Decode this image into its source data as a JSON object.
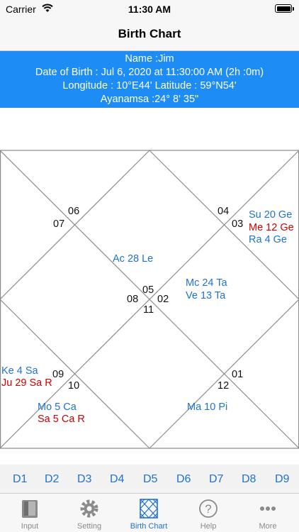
{
  "status_bar": {
    "carrier": "Carrier",
    "time": "11:30 AM"
  },
  "nav": {
    "title": "Birth Chart"
  },
  "info": {
    "name": "Name :Jim",
    "dob": "Date of Birth : Jul 6, 2020 at 11:30:00 AM (2h :0m)",
    "coords": "Longitude : 10°E44' Latitude : 59°N54'",
    "ayanamsa": "Ayanamsa :24° 8' 35\""
  },
  "chart": {
    "house_numbers": {
      "h06": "06",
      "h07": "07",
      "h04": "04",
      "h03": "03",
      "h05": "05",
      "h08": "08",
      "h02": "02",
      "h11": "11",
      "h09": "09",
      "h10": "10",
      "h01": "01",
      "h12": "12"
    },
    "planets": {
      "su": "Su 20 Ge",
      "me": "Me 12 Ge",
      "ra": "Ra 4 Ge",
      "ac": "Ac 28 Le",
      "mc": "Mc 24 Ta",
      "ve": "Ve 13 Ta",
      "ke": "Ke 4 Sa",
      "ju": "Ju 29 Sa R",
      "mo": "Mo 5 Ca",
      "sa": "Sa 5 Ca R",
      "ma": "Ma 10 Pi"
    },
    "colors": {
      "normal": "#1f72d0",
      "retro_or_combust": "#d00000",
      "house_number": "#111111",
      "lines": "#8c8c8c"
    }
  },
  "divisional_tabs": [
    "D1",
    "D2",
    "D3",
    "D4",
    "D5",
    "D6",
    "D7",
    "D8",
    "D9"
  ],
  "tab_bar": {
    "items": [
      {
        "label": "Input",
        "icon": "book-icon"
      },
      {
        "label": "Setting",
        "icon": "gear-icon"
      },
      {
        "label": "Birth Chart",
        "icon": "chart-grid-icon"
      },
      {
        "label": "Help",
        "icon": "help-icon"
      },
      {
        "label": "More",
        "icon": "more-dots-icon"
      }
    ],
    "active_index": 2,
    "active_color": "#1f72d0",
    "inactive_color": "#8a8a8a"
  }
}
